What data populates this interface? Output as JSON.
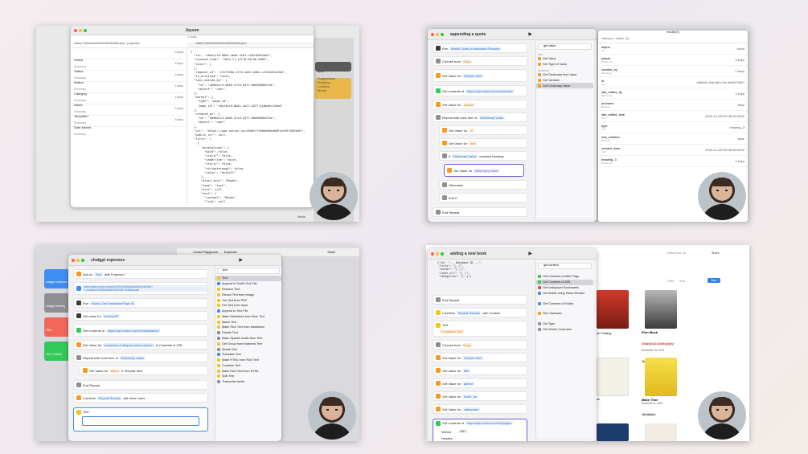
{
  "panel1": {
    "app_title": "Jayson",
    "splits": "2 splits",
    "path_left": "c8a0fc79d0be90eb6091e4f6f3603a9f.json › properties",
    "path_right": "c8a0fc79d0be90eb6091e4f6f3603a9f.json",
    "rows": [
      {
        "key": "Select",
        "type": "Dictionary",
        "count": "4 keys"
      },
      {
        "key": "Status",
        "type": "Dictionary",
        "count": "4 keys"
      },
      {
        "key": "Author",
        "type": "Dictionary",
        "count": "4 keys"
      },
      {
        "key": "Category",
        "type": "Dictionary",
        "count": "4 keys"
      },
      {
        "key": "Name",
        "type": "Dictionary",
        "count": "4 keys"
      },
      {
        "key": "Template?",
        "type": "Dictionary",
        "count": "4 keys"
      },
      {
        "key": "Date Added",
        "type": "Dictionary",
        "count": "4 keys"
      }
    ],
    "json_text": "{\n  \"id\": \"c8ae1cfb-d6be-4bdd-a101-cc811b9b2e62\",\n  \"created_time\": \"2023-11-12T16:46:00.000Z\",\n  \"cover\": {\n  },\n  \"request_id\": \"c31f928a-1f7d-4ad7-b56e-c1216d41a7b0\",\n  \"is_archived\": false,\n  \"last_edited_by\": {\n    \"id\": \"4b58e1c3-d8b5-4f1d-a377-0b05b88427de\",\n    \"object\": \"user\"\n  },\n  \"parent\": {\n    \"type\": \"page_id\",\n    \"page_id\": \"c8e24ec3-8b6c-4a17-b377-b10ba6c2c6a6\"\n  },\n  \"created_by\": {\n    \"id\": \"4b58e1c3-d8b5-4f1d-a377-0b05b88427de\",\n    \"object\": \"user\"\n  },\n  \"url\": \"https://www.notion.so/c8a0fc79d0be90eb6091e4f6f3603a9f\",\n  \"public_url\": null,\n  \"title\": [\n    {\n      \"annotations\": {\n        \"bold\": false,\n        \"italic\": false,\n        \"underline\": false,\n        \"italic\": false,\n        \"strikethrough\": false,\n        \"color\": \"default\"\n      },\n      \"plain_text\": \"Books\",\n      \"type\": \"text\",\n      \"href\": null,\n      \"text\": {\n        \"content\": \"Books\",\n        \"link\": null\n      }\n    }\n  ],\n  \"last_edited_time\": \"2023-12-11T12:37:00.000Z\",\n  \"object\": \"database\",\n  \"icon\": {\n    \"type\": \"external\",\n    \"external\": {\n      \"url\": \"https://...\"",
    "side_items": [
      "Suggestions",
      "Scripting",
      "Location",
      "Media"
    ],
    "side_top": "Apps",
    "side_bottom": "Media"
  },
  "panel2": {
    "title": "appending a quote",
    "search": "get value",
    "actions": [
      {
        "text": "Run",
        "tok": "Notion Query a database Request",
        "extra": "Show More"
      },
      {
        "text": "Choose from",
        "tok": "Keys",
        "extra": "Show More"
      },
      {
        "text": "Get Value for",
        "tok": "Chosen Item",
        "extra": "in"
      },
      {
        "text": "Get contents of",
        "tok": "https://api.notion.com/v1/blocks/.../children",
        "extra": "Show More"
      },
      {
        "text": "Get Value for",
        "tok": "results",
        "extra": "in Contents of URL"
      },
      {
        "text": "Repeat with each item in",
        "tok": "Dictionary Value",
        "extra": ""
      },
      {
        "text": "Get Value for",
        "tok": "id",
        "extra": "in Repeat Item"
      },
      {
        "text": "Get Value for",
        "tok": "text",
        "extra": "in Repeat Item"
      },
      {
        "text": "If",
        "tok": "Dictionary Value",
        "extra": "contains heading"
      },
      {
        "text": "Get Value for",
        "tok": "Dictionary Value",
        "extra": "in"
      },
      {
        "text": "Otherwise",
        "tok": "",
        "extra": ""
      },
      {
        "text": "End If",
        "tok": "",
        "extra": ""
      },
      {
        "text": "End Repeat",
        "tok": "",
        "extra": ""
      }
    ],
    "side_sections": [
      "Text",
      "Dictionary",
      "Variables"
    ],
    "side_items": [
      "Get Value",
      "Get Type of Value",
      "Get Dictionary from Input",
      "Get Variable",
      "Get Dictionary Value"
    ],
    "notion_title": "results(3)",
    "notion_path": "other.json › results › [0]",
    "notion_rows": [
      {
        "key": "object",
        "type": "Text",
        "value": "block"
      },
      {
        "key": "parent",
        "type": "Dictionary",
        "value": "2 keys"
      },
      {
        "key": "created_by",
        "type": "Dictionary",
        "value": "2 keys"
      },
      {
        "key": "id",
        "type": "Text",
        "value": "b2f60444-40a4-4f81-b73e-4b0b627292b7"
      },
      {
        "key": "last_edited_by",
        "type": "Dictionary",
        "value": "2 keys"
      },
      {
        "key": "archived",
        "type": "Boolean",
        "value": "false"
      },
      {
        "key": "last_edited_time",
        "type": "Text",
        "value": "2023-12-26T15:48:00.000Z"
      },
      {
        "key": "type",
        "type": "Text",
        "value": "heading_3"
      },
      {
        "key": "has_children",
        "type": "Boolean",
        "value": "false"
      },
      {
        "key": "created_time",
        "type": "Text",
        "value": "2023-12-26T15:48:00.000Z"
      },
      {
        "key": "heading_3",
        "type": "Dictionary",
        "value": "3 keys"
      }
    ]
  },
  "panel3": {
    "title": "chatgpt expenses",
    "browser_tab1": "Course Playground",
    "browser_tab2": "Expenses",
    "share": "Share",
    "search": "text",
    "actions": [
      {
        "text": "Ask for",
        "tok": "Text",
        "extra": "with Expense?"
      },
      {
        "text": "",
        "tok": "https://www.notion.so/ba5a12551c92e6a5ab0d5c52d4e5b4?v=ecd8d2220f195d16f5f/d7557f56776482afsdc8",
        "extra": ""
      },
      {
        "text": "Run",
        "tok": "Notion Get Database/Page ID",
        "extra": "Show More"
      },
      {
        "text": "Get value for",
        "tok": "NotionAPI",
        "extra": "Show More"
      },
      {
        "text": "Get contents of",
        "tok": "https://api.notion.com/v1/databases/",
        "extra": "Show More"
      },
      {
        "text": "Get Value for",
        "tok": "properties.Category.select.options",
        "extra": "in Contents of URL"
      },
      {
        "text": "Repeat with each item in",
        "tok": "Dictionary Value",
        "extra": ""
      },
      {
        "text": "Get Value for",
        "tok": "name",
        "extra": "in Repeat Item"
      },
      {
        "text": "End Repeat",
        "tok": "",
        "extra": ""
      },
      {
        "text": "Combine",
        "tok": "Repeat Results",
        "extra": "with New Lines"
      },
      {
        "text": "Text",
        "tok": "",
        "extra": ""
      }
    ],
    "side_items": [
      "Text",
      "Append to Drafts Text File",
      "Replace Text",
      "Extract Text from Image",
      "Get Text from PDF",
      "Get Text from Input",
      "Append to Text File",
      "Make Markdown from Rich Text",
      "Match Text",
      "Make Rich Text from Markdown",
      "Dictate Text",
      "Make Spoken Audio from Text",
      "Get Group from Matched Text",
      "Speak Text",
      "Translate Text",
      "Make HTML from Rich Text",
      "Combine Text",
      "Make Rich Text from HTML",
      "Split Text",
      "Transcribe Audio"
    ],
    "home_tiles": [
      "chatgpt expenses",
      "chatgpt learning",
      "Filter",
      "Get Contents"
    ]
  },
  "panel4": {
    "title": "adding a new book",
    "search": "get content",
    "json_snippet": "{\"id\": \"... Database ID ...\",\n \"title\": \"[..]\",\n \"author\": \"[..]\",\n \"cover_url\": \"[..]\",\n \"categories\": \"[..]\"}",
    "actions": [
      {
        "text": "End Repeat",
        "tok": "",
        "extra": ""
      },
      {
        "text": "Combine",
        "tok": "Repeat Results",
        "extra": "with Custom"
      },
      {
        "text": "Text",
        "tok": "Combined Text",
        "extra": ""
      },
      {
        "text": "Choose from",
        "tok": "Keys",
        "extra": "Show More"
      },
      {
        "text": "Get Value for",
        "tok": "Chosen Item",
        "extra": "in Text"
      },
      {
        "text": "Get Value for",
        "tok": "title",
        "extra": "in Dictionary Value"
      },
      {
        "text": "Get Value for",
        "tok": "author",
        "extra": "in Dictionary Value"
      },
      {
        "text": "Get Value for",
        "tok": "cover_url",
        "extra": "in Dictionary Value"
      },
      {
        "text": "Get Value for",
        "tok": "categories",
        "extra": "in Dictionary Value"
      },
      {
        "text": "Get contents of",
        "tok": "https://api.notion.com/v1/pages",
        "extra": "Show Less"
      }
    ],
    "method_label": "Method",
    "method_value": "GET",
    "headers_label": "Headers",
    "side_items": [
      "Get Contents of Web Page",
      "Get Contents of URL",
      "Get Instapaper Bookmarks",
      "Get Article using Safari Reader",
      "Get Contents of Folder",
      "Get Clipboard",
      "Get Type",
      "Get What's Onscreen"
    ],
    "notion_edited": "Edited Dec 16",
    "notion_share": "Share",
    "filter": "Filter",
    "sort": "Sort",
    "new_btn": "New",
    "books": [
      {
        "title": "Elon Musk",
        "tag": "Biography & Autobiography",
        "date": "December 19, 2023",
        "status": "Not started"
      },
      {
        "title": "Make Time",
        "tag": "",
        "date": "December 2, 2023",
        "status": "Not started"
      }
    ],
    "partial_labels": [
      "ve Thinking",
      "ue"
    ]
  }
}
